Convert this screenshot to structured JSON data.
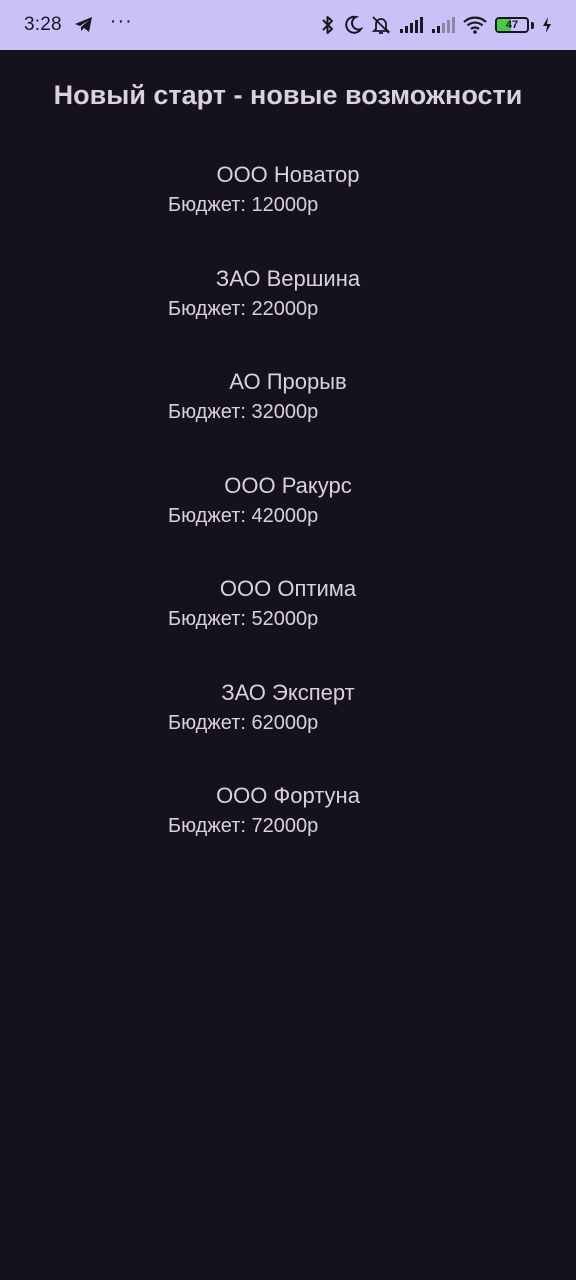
{
  "status_bar": {
    "time": "3:28",
    "overflow": "···",
    "battery_level": "47",
    "battery_percent": 47,
    "icons": [
      "telegram-icon",
      "bluetooth-icon",
      "moon-icon",
      "bell-off-icon",
      "signal-icon",
      "signal-icon",
      "wifi-icon",
      "battery-icon",
      "charging-icon"
    ]
  },
  "title": "Новый старт - новые возможности",
  "companies": [
    {
      "name": "ООО Новатор",
      "budget": "Бюджет: 12000р"
    },
    {
      "name": "ЗАО Вершина",
      "budget": "Бюджет: 22000р"
    },
    {
      "name": "АО Прорыв",
      "budget": "Бюджет: 32000р"
    },
    {
      "name": "ООО Ракурс",
      "budget": "Бюджет: 42000р"
    },
    {
      "name": "ООО Оптима",
      "budget": "Бюджет: 52000р"
    },
    {
      "name": "ЗАО Эксперт",
      "budget": "Бюджет: 62000р"
    },
    {
      "name": "ООО Фортуна",
      "budget": "Бюджет: 72000р"
    }
  ],
  "colors": {
    "background": "#15121b",
    "status_bar": "#ccc0f8",
    "text": "#d8d2df",
    "battery_fill": "#4cc84a"
  }
}
